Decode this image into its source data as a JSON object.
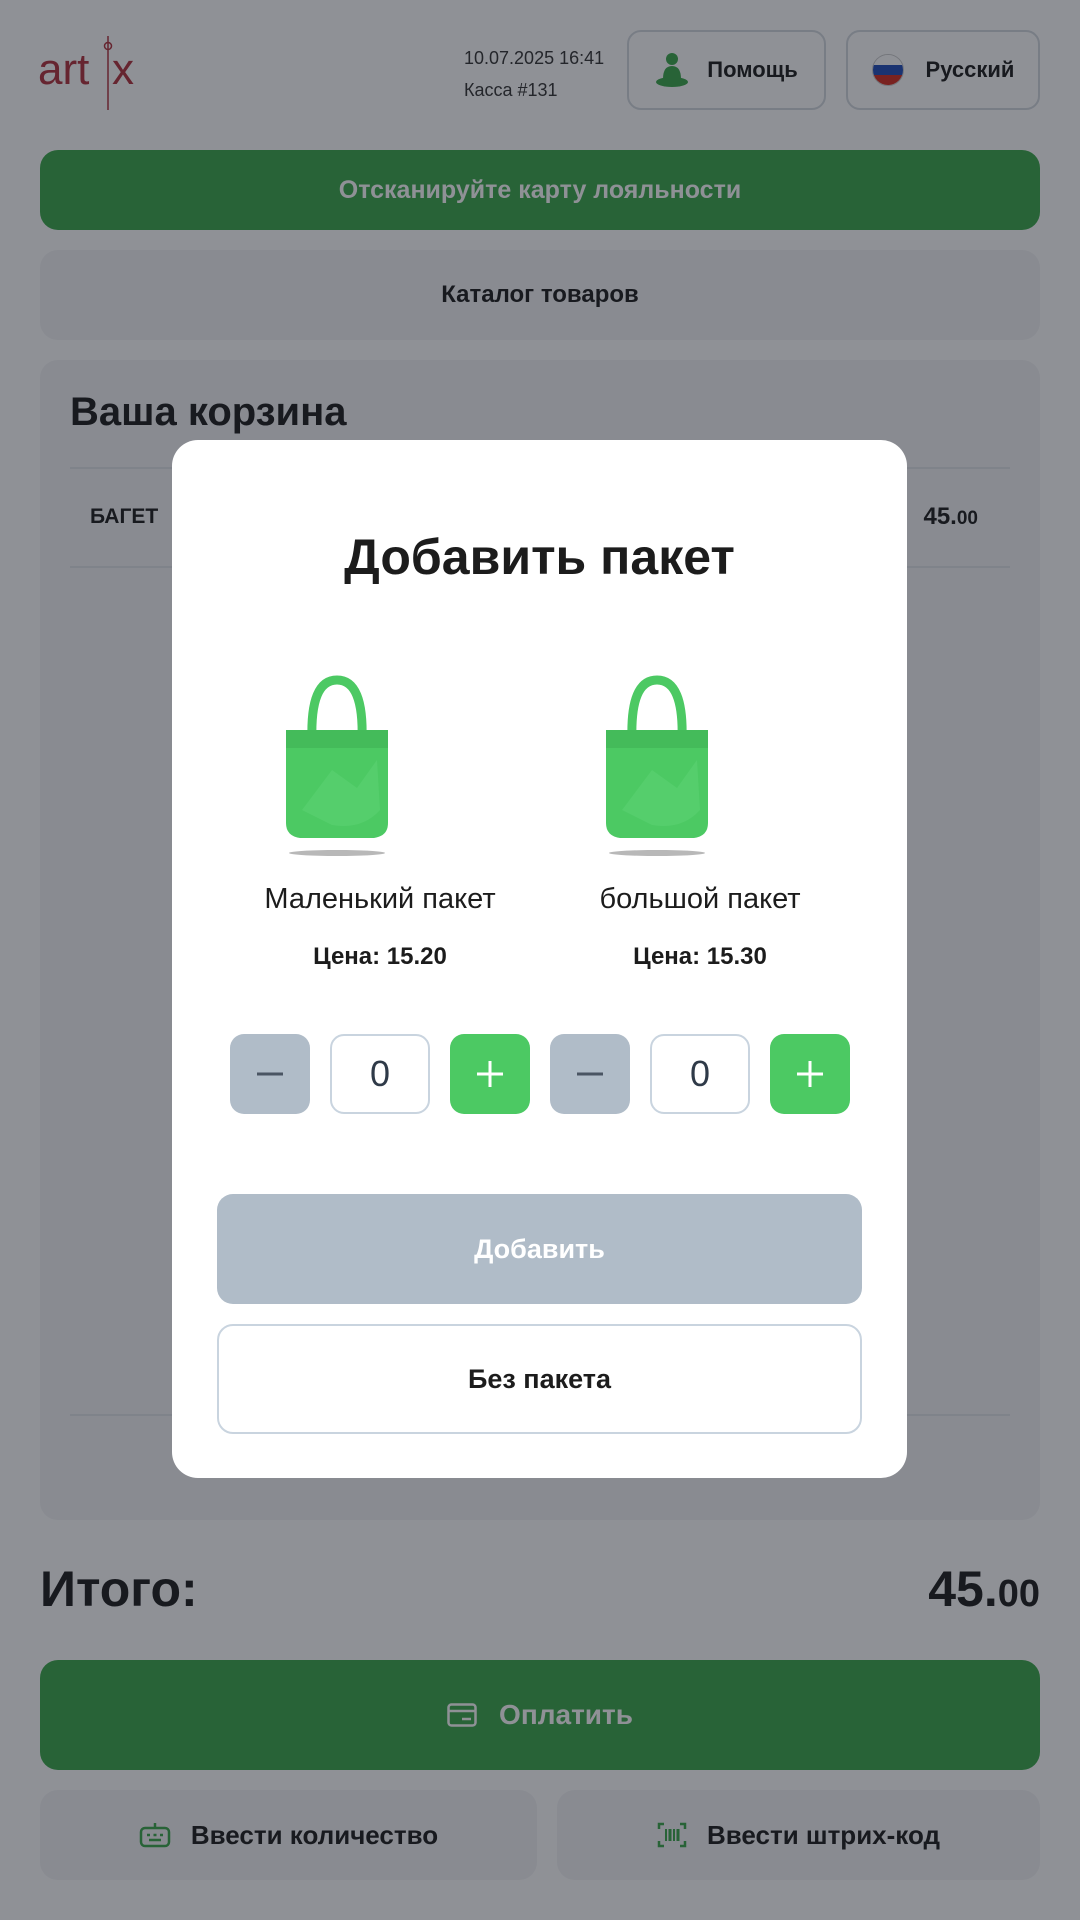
{
  "header": {
    "date_time": "10.07.2025 16:41",
    "register": "Касса #131",
    "help_label": "Помощь",
    "language_label": "Русский"
  },
  "loyalty_button": "Отсканируйте карту лояльности",
  "catalog_button": "Каталог товаров",
  "cart": {
    "title": "Ваша корзина",
    "items": [
      {
        "name": "БАГЕТ",
        "price_main": "45.",
        "price_cents": "00"
      }
    ]
  },
  "total": {
    "label": "Итого:",
    "value_main": "45.",
    "value_cents": "00"
  },
  "actions": {
    "pay_label": "Оплатить",
    "enter_quantity_label": "Ввести количество",
    "enter_barcode_label": "Ввести штрих-код"
  },
  "modal": {
    "title": "Добавить пакет",
    "bags": [
      {
        "name": "Маленький пакет",
        "price": "Цена: 15.20",
        "quantity": "0"
      },
      {
        "name": "большой пакет",
        "price": "Цена: 15.30",
        "quantity": "0"
      }
    ],
    "add_label": "Добавить",
    "no_bag_label": "Без пакета"
  },
  "colors": {
    "brand_green": "#3aa84a",
    "accent_green": "#4cc963",
    "disabled_gray": "#b0bcc8",
    "logo_red": "#b0313c"
  },
  "icons": [
    "help-person-icon",
    "russian-flag-icon",
    "card-icon",
    "keyboard-icon",
    "barcode-icon",
    "bag-icon",
    "minus-icon",
    "plus-icon"
  ]
}
